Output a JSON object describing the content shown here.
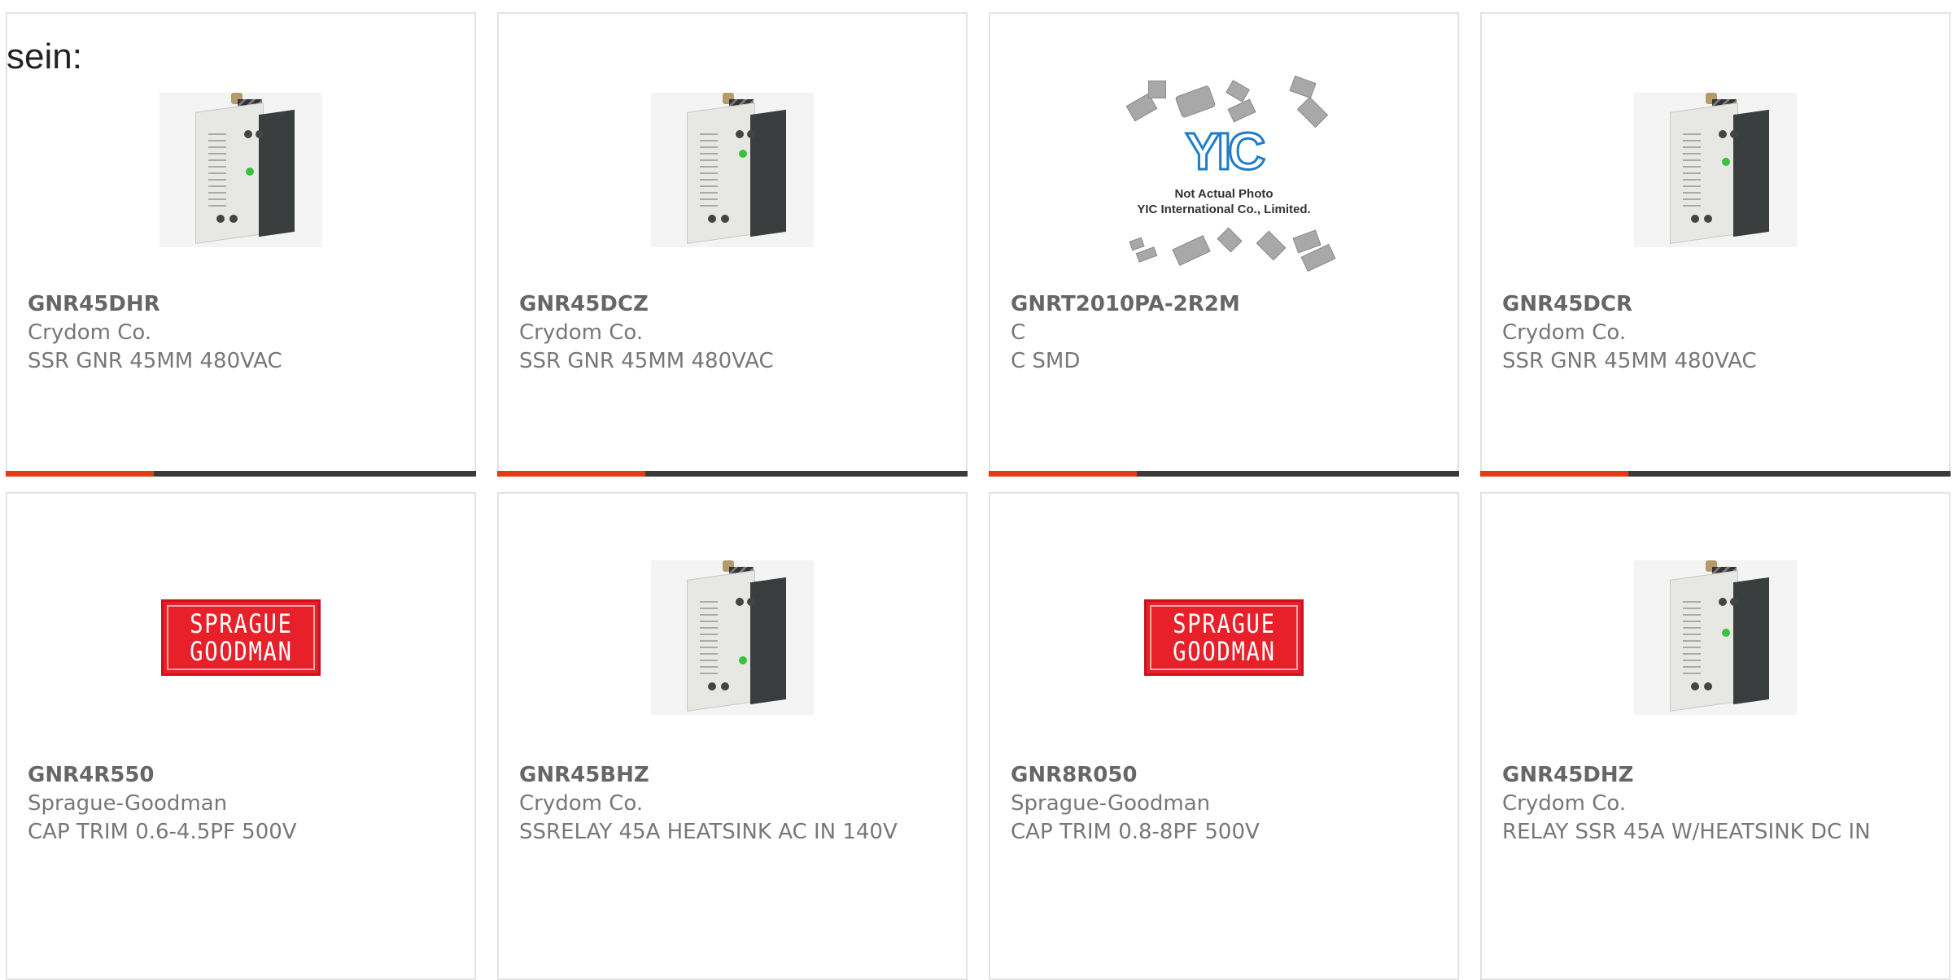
{
  "intro": {
    "text": "sein:"
  },
  "colors": {
    "accent_bar": "#e63b12",
    "dark_bar": "#3a3a3a",
    "card_border": "#e3e3e3",
    "sprague_red": "#e8202a",
    "yic_blue": "#1f7cc7"
  },
  "products": [
    {
      "part_no": "GNR45DHR",
      "manufacturer": "Crydom Co.",
      "description": "SSR GNR 45MM 480VAC",
      "image": "relay-photo"
    },
    {
      "part_no": "GNR45DCZ",
      "manufacturer": "Crydom Co.",
      "description": "SSR GNR 45MM 480VAC",
      "image": "relay-photo"
    },
    {
      "part_no": "GNRT2010PA-2R2M",
      "manufacturer": "C",
      "description": "C SMD",
      "image": "yic-placeholder",
      "placeholder_logo": "YIC",
      "placeholder_line_1": "Not Actual Photo",
      "placeholder_line_2": "YIC International Co., Limited."
    },
    {
      "part_no": "GNR45DCR",
      "manufacturer": "Crydom Co.",
      "description": "SSR GNR 45MM 480VAC",
      "image": "relay-photo"
    },
    {
      "part_no": "GNR4R550",
      "manufacturer": "Sprague-Goodman",
      "description": "CAP TRIM 0.6-4.5PF 500V",
      "image": "sprague-goodman-logo",
      "logo_line_1": "SPRAGUE",
      "logo_line_2": "GOODMAN"
    },
    {
      "part_no": "GNR45BHZ",
      "manufacturer": "Crydom Co.",
      "description": "SSRELAY 45A HEATSINK AC IN 140V",
      "image": "relay-photo"
    },
    {
      "part_no": "GNR8R050",
      "manufacturer": "Sprague-Goodman",
      "description": "CAP TRIM 0.8-8PF 500V",
      "image": "sprague-goodman-logo",
      "logo_line_1": "SPRAGUE",
      "logo_line_2": "GOODMAN"
    },
    {
      "part_no": "GNR45DHZ",
      "manufacturer": "Crydom Co.",
      "description": "RELAY SSR 45A W/HEATSINK DC IN",
      "image": "relay-photo"
    }
  ]
}
